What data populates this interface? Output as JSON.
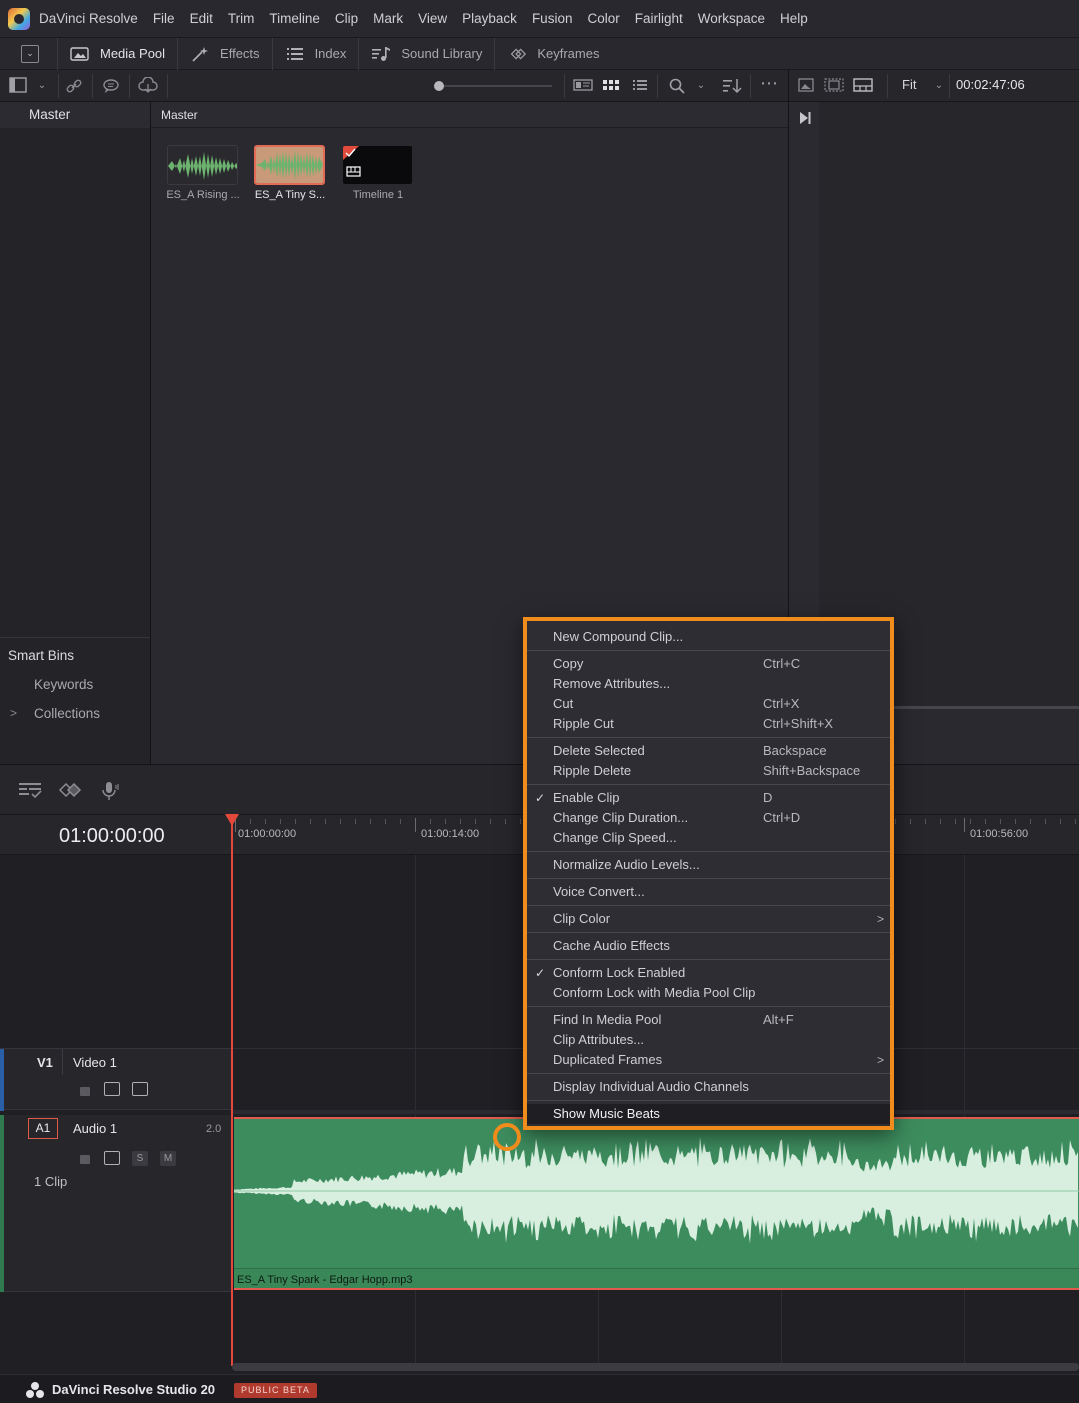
{
  "menubar": {
    "app_name": "DaVinci Resolve",
    "items": [
      "File",
      "Edit",
      "Trim",
      "Timeline",
      "Clip",
      "Mark",
      "View",
      "Playback",
      "Fusion",
      "Color",
      "Fairlight",
      "Workspace",
      "Help"
    ]
  },
  "toolbar": {
    "media_pool": "Media Pool",
    "effects": "Effects",
    "index": "Index",
    "sound_library": "Sound Library",
    "keyframes": "Keyframes"
  },
  "subtoolbar": {
    "fit": "Fit",
    "timecode": "00:02:47:06"
  },
  "bin_panel": {
    "header": "Master",
    "smart_bins": "Smart Bins",
    "keywords": "Keywords",
    "collections": "Collections"
  },
  "media_pool": {
    "header": "Master",
    "clips": [
      "ES_A Rising ...",
      "ES_A Tiny S...",
      "Timeline 1"
    ]
  },
  "timeline": {
    "timecode": "01:00:00:00",
    "ruler": [
      "01:00:00:00",
      "01:00:14:00",
      "01:00:56:00"
    ],
    "video_track": {
      "tag": "V1",
      "name": "Video 1"
    },
    "audio_track": {
      "tag": "A1",
      "name": "Audio 1",
      "channels": "2.0",
      "clip_count": "1 Clip",
      "solo": "S",
      "mute": "M"
    },
    "audio_clip_name": "ES_A Tiny Spark - Edgar Hopp.mp3"
  },
  "context_menu": {
    "new_compound_clip": "New Compound Clip...",
    "copy": "Copy",
    "copy_sc": "Ctrl+C",
    "remove_attributes": "Remove Attributes...",
    "cut": "Cut",
    "cut_sc": "Ctrl+X",
    "ripple_cut": "Ripple Cut",
    "ripple_cut_sc": "Ctrl+Shift+X",
    "delete_selected": "Delete Selected",
    "delete_selected_sc": "Backspace",
    "ripple_delete": "Ripple Delete",
    "ripple_delete_sc": "Shift+Backspace",
    "enable_clip": "Enable Clip",
    "enable_clip_sc": "D",
    "change_clip_duration": "Change Clip Duration...",
    "change_clip_duration_sc": "Ctrl+D",
    "change_clip_speed": "Change Clip Speed...",
    "normalize_audio": "Normalize Audio Levels...",
    "voice_convert": "Voice Convert...",
    "clip_color": "Clip Color",
    "cache_audio_effects": "Cache Audio Effects",
    "conform_lock_enabled": "Conform Lock Enabled",
    "conform_lock_media_pool": "Conform Lock with Media Pool Clip",
    "find_in_media_pool": "Find In Media Pool",
    "find_in_media_pool_sc": "Alt+F",
    "clip_attributes": "Clip Attributes...",
    "duplicated_frames": "Duplicated Frames",
    "display_audio_channels": "Display Individual Audio Channels",
    "show_music_beats": "Show Music Beats"
  },
  "footer": {
    "product": "DaVinci Resolve Studio 20",
    "badge": "PUBLIC BETA"
  },
  "colors": {
    "accent_orange": "#f08c1c",
    "playhead": "#e2483b",
    "audio_clip": "#3d8c5e"
  }
}
